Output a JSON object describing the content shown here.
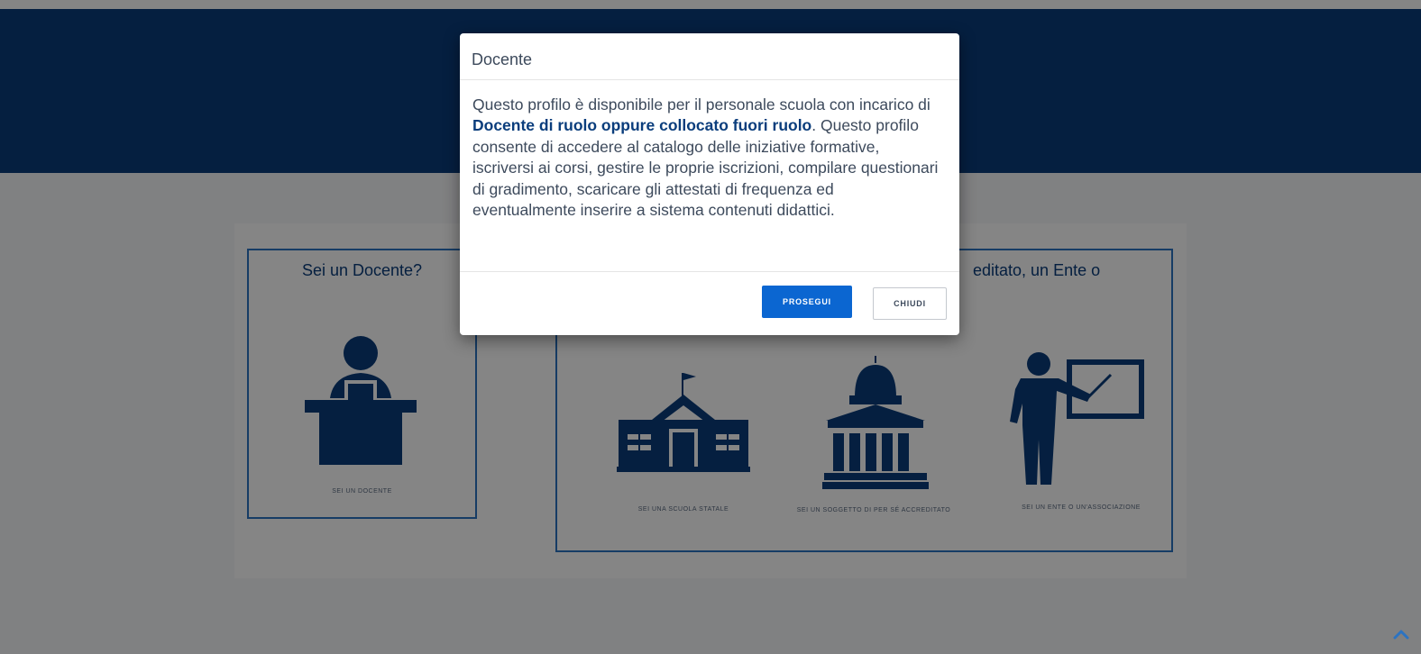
{
  "background_cards": {
    "docente": {
      "title": "Sei un Docente?",
      "caption": "SEI UN DOCENTE"
    },
    "enti": {
      "title_visible_part": "editato, un Ente o",
      "items": [
        {
          "caption": "SEI UNA SCUOLA STATALE",
          "icon": "school-building-icon"
        },
        {
          "caption": "SEI UN SOGGETTO DI PER SÉ ACCREDITATO",
          "icon": "capitol-building-icon"
        },
        {
          "caption": "SEI UN ENTE O UN'ASSOCIAZIONE",
          "icon": "teacher-board-icon"
        }
      ]
    }
  },
  "modal": {
    "title": "Docente",
    "body_part1": "Questo profilo è disponibile per il personale scuola con incarico di ",
    "body_bold": "Docente di ruolo oppure collocato fuori ruolo",
    "body_part2": ". Questo profilo consente di accedere al catalogo delle iniziative formative, iscriversi ai corsi, gestire le proprie iscrizioni, compilare questionari di gradimento, scaricare gli attestati di frequenza ed eventualmente inserire a sistema contenuti didattici.",
    "primary_button": "PROSEGUI",
    "secondary_button": "CHIUDI"
  },
  "colors": {
    "header": "#0a3d7c",
    "icon": "#0a3d7c",
    "card_border": "#2b73c2",
    "primary_button": "#0b66d1"
  },
  "icons": {
    "scroll_top": "chevron-up-icon"
  }
}
